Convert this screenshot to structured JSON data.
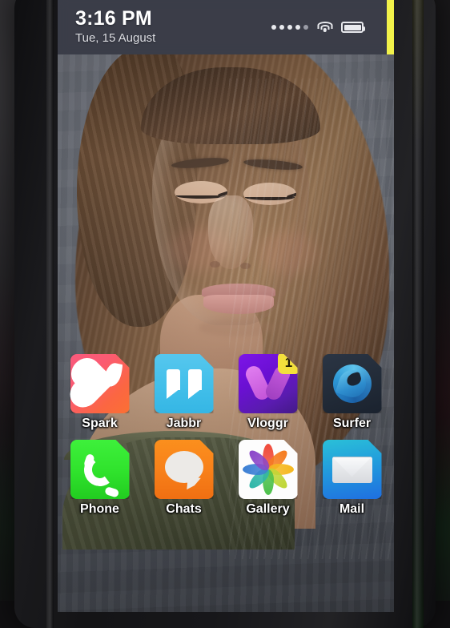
{
  "device": {
    "kind": "smartphone-mockup",
    "backdrop_color": "#1a191b",
    "body_color": "#17171a"
  },
  "statusbar": {
    "time": "3:16 PM",
    "date": "Tue, 15 August",
    "background_color": "#3e414d",
    "accent_strip_color": "#f2f24a",
    "signal": {
      "icon": "signal-dots-icon",
      "total_dots": 5,
      "filled_dots": 4
    },
    "wifi": {
      "icon": "wifi-icon",
      "state": "connected"
    },
    "battery": {
      "icon": "battery-icon",
      "level_percent": 100
    }
  },
  "wallpaper": {
    "name": "portrait-photo-wallpaper",
    "description": "Portrait of a woman with long brown hair looking down, olive off-shoulder top, gray curtain background"
  },
  "homescreen": {
    "apps": [
      {
        "name": "Spark",
        "icon": "heart-flame-icon",
        "color": "#fb5b72",
        "badge": null
      },
      {
        "name": "Jabbr",
        "icon": "quotation-marks-icon",
        "color": "#42bfea",
        "badge": null
      },
      {
        "name": "Vloggr",
        "icon": "letter-v-icon",
        "color": "#6a10d2",
        "badge": "1"
      },
      {
        "name": "Surfer",
        "icon": "swirl-browser-icon",
        "color": "#222b38",
        "badge": null
      },
      {
        "name": "Phone",
        "icon": "telephone-handset-icon",
        "color": "#2fe22c",
        "badge": null
      },
      {
        "name": "Chats",
        "icon": "speech-bubble-icon",
        "color": "#f8811a",
        "badge": null
      },
      {
        "name": "Gallery",
        "icon": "flower-pinwheel-icon",
        "color": "#ffffff",
        "badge": null
      },
      {
        "name": "Mail",
        "icon": "envelope-icon",
        "color": "#2196dd",
        "badge": null
      }
    ],
    "gallery_petal_colors": [
      "#f04a3a",
      "#f57c20",
      "#f5b81f",
      "#bfd636",
      "#4cc04a",
      "#2fb6a8",
      "#3b7fd4",
      "#8b46c9"
    ],
    "badge_color": "#f3e03c"
  }
}
